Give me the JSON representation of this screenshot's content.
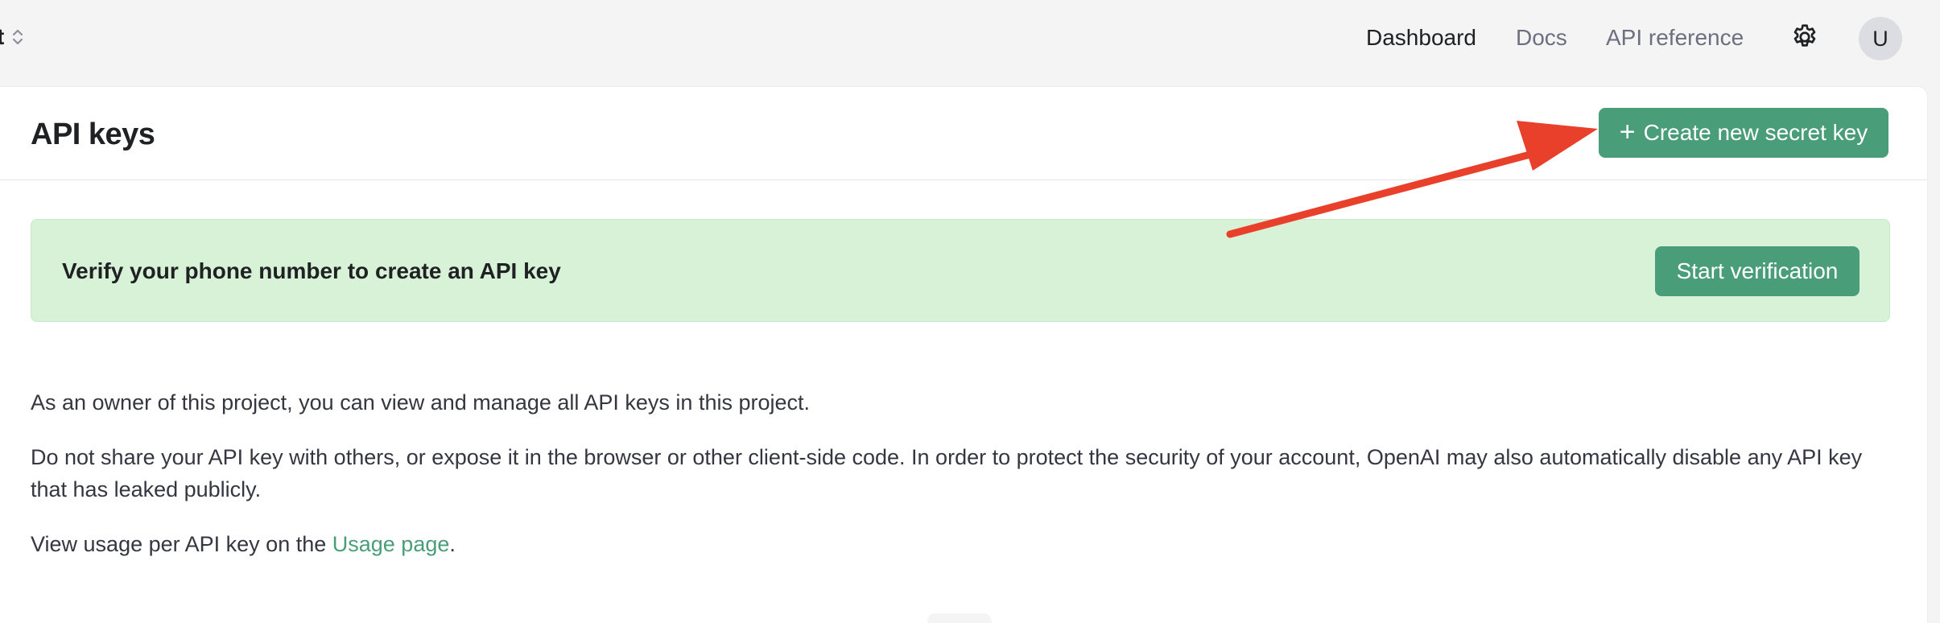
{
  "topbar": {
    "project_name": "t",
    "nav": [
      {
        "label": "Dashboard",
        "active": true
      },
      {
        "label": "Docs",
        "active": false
      },
      {
        "label": "API reference",
        "active": false
      }
    ],
    "avatar_initial": "U",
    "settings_icon": "gear-icon"
  },
  "page": {
    "title": "API keys",
    "create_button": {
      "icon": "+",
      "label": "Create new secret key"
    }
  },
  "verify_banner": {
    "text": "Verify your phone number to create an API key",
    "button_label": "Start verification"
  },
  "body": {
    "para1": "As an owner of this project, you can view and manage all API keys in this project.",
    "para2": "Do not share your API key with others, or expose it in the browser or other client-side code. In order to protect the security of your account, OpenAI may also automatically disable any API key that has leaked publicly.",
    "para3_prefix": "View usage per API key on the ",
    "para3_link": "Usage page",
    "para3_suffix": "."
  },
  "colors": {
    "accent": "#4a9d79",
    "banner_bg": "#d8f2d8",
    "annotation_arrow": "#e8402a"
  }
}
